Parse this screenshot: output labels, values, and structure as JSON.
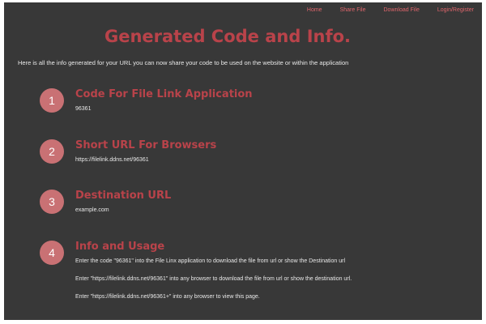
{
  "nav": {
    "items": [
      {
        "label": "Home"
      },
      {
        "label": "Share File"
      },
      {
        "label": "Download File"
      },
      {
        "label": "Login/Register"
      }
    ]
  },
  "page": {
    "title": "Generated Code and Info.",
    "intro": "Here is all the info generated for your URL you can now share your code to be used on the website or within the application"
  },
  "steps": [
    {
      "number": "1",
      "title": "Code For File Link Application",
      "value": "96361"
    },
    {
      "number": "2",
      "title": "Short URL For Browsers",
      "value": "https://filelink.ddns.net/96361"
    },
    {
      "number": "3",
      "title": "Destination URL",
      "value": "example.com"
    },
    {
      "number": "4",
      "title": "Info and Usage",
      "lines": [
        "Enter the code \"96361\" into the File Linx application to download the file from url or show the Destination url",
        "Enter \"https://filelink.ddns.net/96361\" into any browser to download the file from url or show the destination url.",
        "Enter \"https://filelink.ddns.net/96361+\" into any browser to view this page."
      ]
    }
  ],
  "colors": {
    "background": "#383838",
    "accent": "#b9434a",
    "nav_link": "#e0666c",
    "badge": "#c97174"
  }
}
